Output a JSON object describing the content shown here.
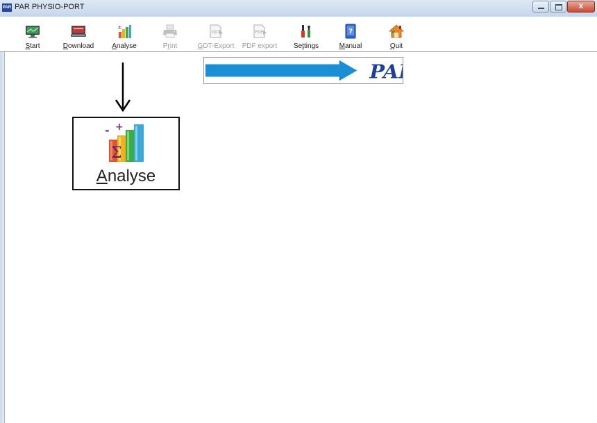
{
  "window": {
    "title": "PAR PHYSIO-PORT",
    "app_icon_text": "PAR",
    "close_glyph": "x"
  },
  "toolbar": {
    "items": [
      {
        "label_u": "S",
        "label_rest": "tart",
        "icon": "start-monitor-icon",
        "enabled": true
      },
      {
        "label_u": "D",
        "label_rest": "ownload",
        "icon": "download-monitor-icon",
        "enabled": true
      },
      {
        "label_u": "A",
        "label_rest": "nalyse",
        "icon": "analyse-chart-icon",
        "enabled": true
      },
      {
        "label_pre": "P",
        "label_u": "r",
        "label_rest": "int",
        "icon": "printer-icon",
        "enabled": false
      },
      {
        "label_u": "G",
        "label_rest": "DT-Export",
        "icon": "gdt-export-icon",
        "enabled": false
      },
      {
        "label_rest": "PDF export",
        "icon": "pdf-export-icon",
        "enabled": false
      },
      {
        "label_pre": "Se",
        "label_u": "t",
        "label_rest": "tings",
        "icon": "settings-tools-icon",
        "enabled": true
      },
      {
        "label_u": "M",
        "label_rest": "anual",
        "icon": "manual-book-icon",
        "enabled": true
      },
      {
        "label_u": "Q",
        "label_rest": "uit",
        "icon": "quit-house-icon",
        "enabled": true
      }
    ]
  },
  "logo": {
    "text": "PAR"
  },
  "callout": {
    "label_u": "A",
    "label_rest": "nalyse",
    "icon": "analyse-chart-icon"
  },
  "colors": {
    "logo_blue": "#1a8fd6",
    "logo_text": "#1e3f98"
  }
}
